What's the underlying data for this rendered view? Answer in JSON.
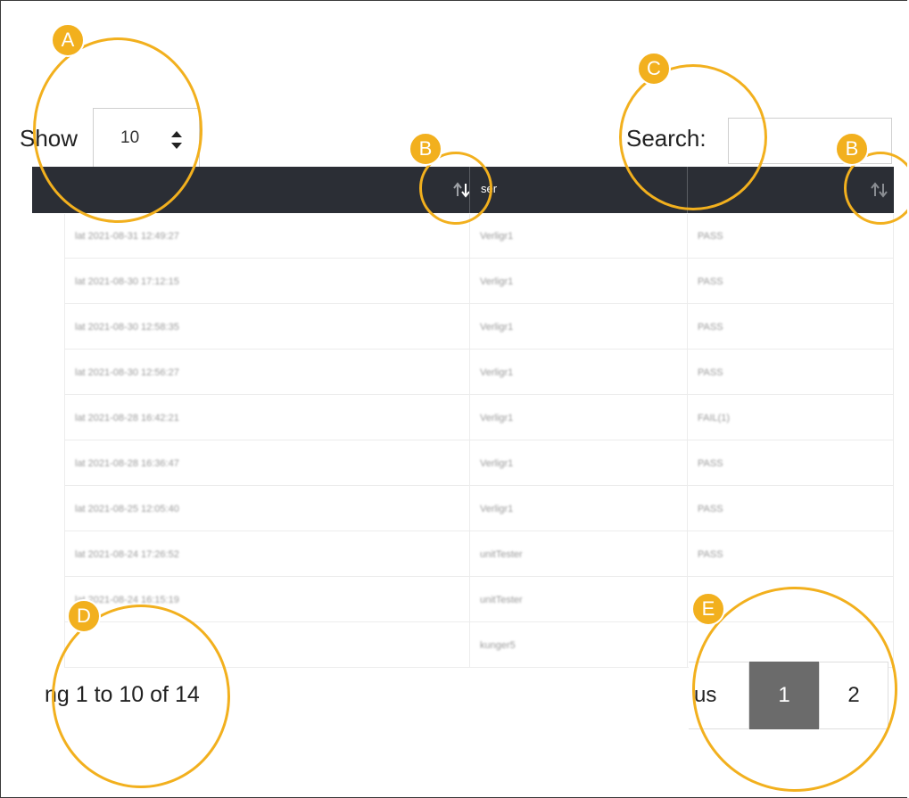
{
  "length_control": {
    "label": "Show",
    "value": "10"
  },
  "search": {
    "label": "Search:",
    "value": ""
  },
  "table": {
    "headers": [
      "",
      "ser",
      ""
    ],
    "rows": [
      [
        "lat 2021-08-31 12:49:27",
        "Verligr1",
        "PASS"
      ],
      [
        "lat 2021-08-30 17:12:15",
        "Verligr1",
        "PASS"
      ],
      [
        "lat 2021-08-30 12:58:35",
        "Verligr1",
        "PASS"
      ],
      [
        "lat 2021-08-30 12:56:27",
        "Verligr1",
        "PASS"
      ],
      [
        "lat 2021-08-28 16:42:21",
        "Verligr1",
        "FAIL(1)"
      ],
      [
        "lat 2021-08-28 16:36:47",
        "Verligr1",
        "PASS"
      ],
      [
        "lat 2021-08-25 12:05:40",
        "Verligr1",
        "PASS"
      ],
      [
        "lat 2021-08-24 17:26:52",
        "unitTester",
        "PASS"
      ],
      [
        "lat 2021-08-24 16:15:19",
        "unitTester",
        ""
      ],
      [
        "",
        "kunger5",
        ""
      ]
    ]
  },
  "info": {
    "text": "ng 1 to 10 of 14"
  },
  "pagination": {
    "previous_label": "us",
    "pages": [
      "1",
      "2"
    ],
    "active_page": "1"
  },
  "annotations": {
    "A": "A",
    "B": "B",
    "C": "C",
    "D": "D",
    "E": "E"
  },
  "colors": {
    "callout": "#f2b01e",
    "header_bg": "#2b2e35",
    "active_page_bg": "#6b6b6b"
  },
  "icons": {
    "length_arrows": "up-down-caret-icon",
    "sort": "sort-arrows-icon"
  }
}
